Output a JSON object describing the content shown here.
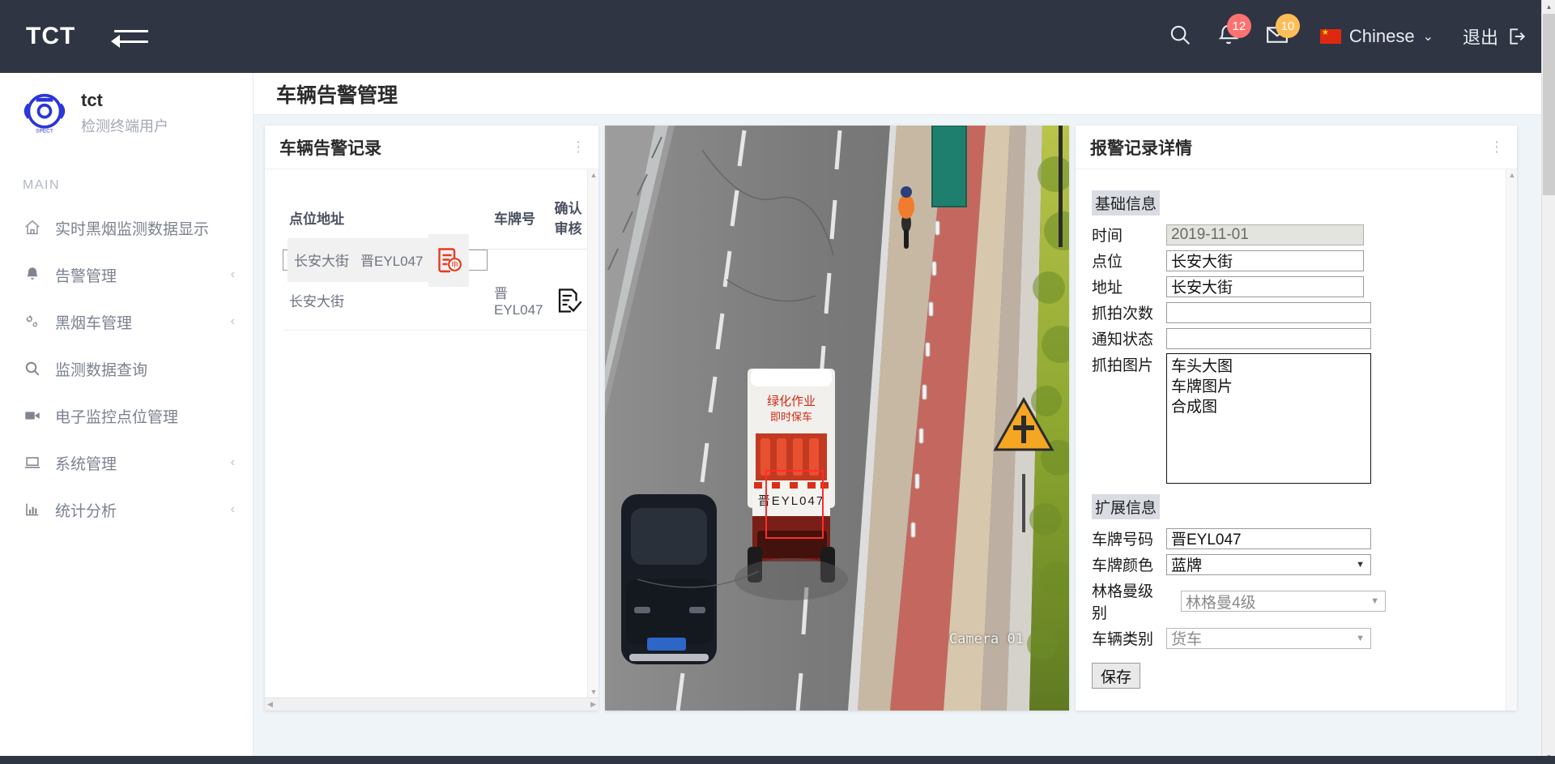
{
  "topbar": {
    "brand": "TCT",
    "menu_toggle_name": "collapse-menu",
    "search_icon": "search-icon",
    "bell_icon": "bell-icon",
    "bell_badge": "12",
    "mail_icon": "mail-icon",
    "mail_badge": "10",
    "language": "Chinese",
    "language_caret": "⌄",
    "logout": "退出",
    "badge_red": "#ff7272",
    "badge_orange": "#ffbd57",
    "bar_color": "#2f3542"
  },
  "sidebar": {
    "logo_title": "tct",
    "logo_subtitle": "检测终端用户",
    "section_label": "MAIN",
    "items": [
      {
        "label": "实时黑烟监测数据显示",
        "icon": "home-icon",
        "caret": ""
      },
      {
        "label": "告警管理",
        "icon": "bell-icon",
        "caret": "‹"
      },
      {
        "label": "黑烟车管理",
        "icon": "gears-icon",
        "caret": "‹"
      },
      {
        "label": "监测数据查询",
        "icon": "search-icon",
        "caret": ""
      },
      {
        "label": "电子监控点位管理",
        "icon": "video-camera-icon",
        "caret": ""
      },
      {
        "label": "系统管理",
        "icon": "laptop-icon",
        "caret": "‹"
      },
      {
        "label": "统计分析",
        "icon": "bar-chart-icon",
        "caret": "‹"
      }
    ]
  },
  "page": {
    "title": "车辆告警管理"
  },
  "records_card": {
    "title": "车辆告警记录",
    "menu_icon": "kebab-menu-icon",
    "columns": [
      "点位地址",
      "车牌号",
      "确认审核"
    ],
    "rows": [
      {
        "location": "长安大街",
        "plate": "晋EYL047",
        "action_icon": "review-pending-icon",
        "selected": true
      },
      {
        "location": "长安大街",
        "plate": "晋EYL047",
        "action_icon": "review-done-icon",
        "selected": false
      }
    ]
  },
  "video_card": {
    "camera_label": "Camera 01",
    "detection_box_color": "#ff2d2d",
    "truck_text_line1": "绿化作业",
    "truck_plate": "晋EYL047"
  },
  "detail_card": {
    "title": "报警记录详情",
    "menu_icon": "kebab-menu-icon",
    "section_basic": "基础信息",
    "section_extended": "扩展信息",
    "fields": {
      "time_label": "时间",
      "time_value": "2019-11-01",
      "point_label": "点位",
      "point_value": "长安大街",
      "address_label": "地址",
      "address_value": "长安大街",
      "capture_count_label": "抓拍次数",
      "capture_count_value": "",
      "notify_state_label": "通知状态",
      "notify_state_value": "",
      "capture_images_label": "抓拍图片",
      "capture_images_options": [
        "车头大图",
        "车牌图片",
        "合成图"
      ],
      "plate_number_label": "车牌号码",
      "plate_number_value": "晋EYL047",
      "plate_color_label": "车牌颜色",
      "plate_color_value": "蓝牌",
      "ringelmann_label": "林格曼级别",
      "ringelmann_value": "林格曼4级",
      "vehicle_type_label": "车辆类别",
      "vehicle_type_value": "货车"
    },
    "save_button": "保存"
  },
  "scrollbars": {
    "up_arrow": "▲",
    "down_arrow": "▼",
    "left_arrow": "◀",
    "right_arrow": "▶"
  }
}
